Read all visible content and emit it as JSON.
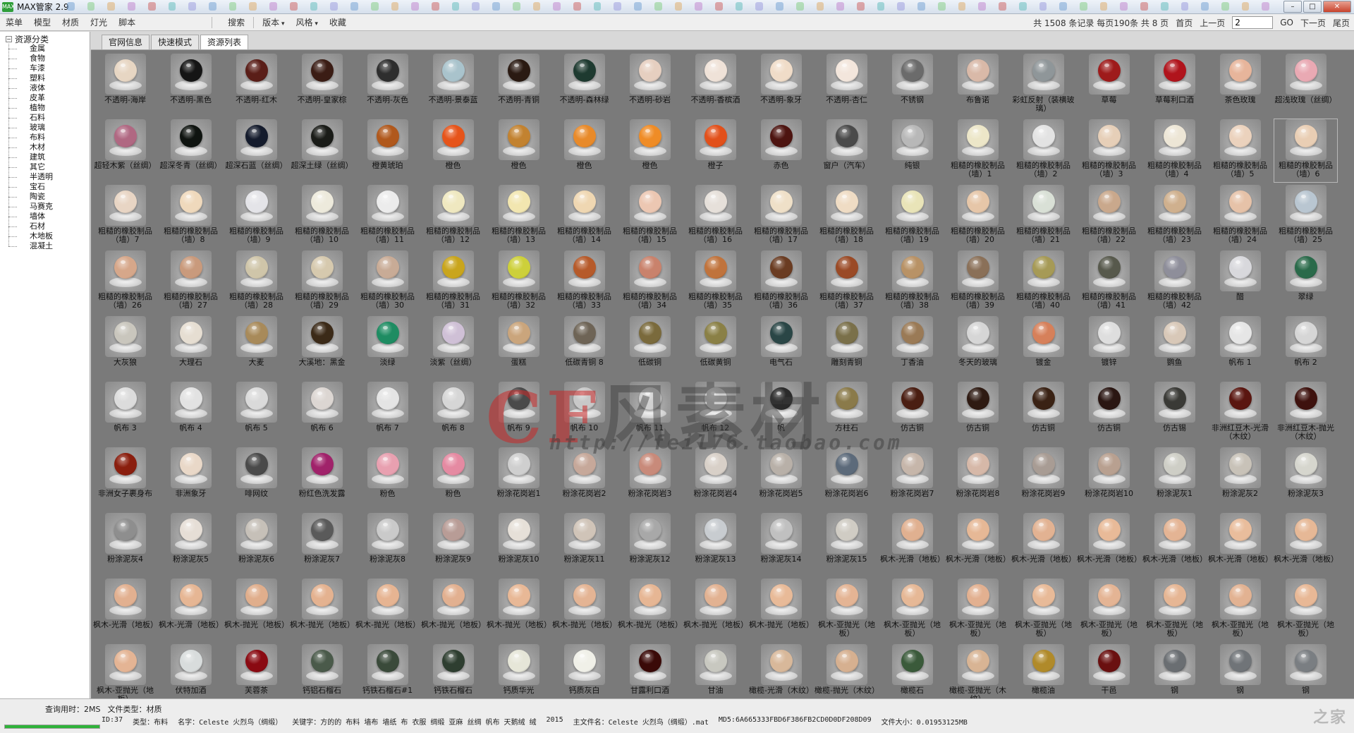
{
  "window": {
    "title": "MAX管家 2.9",
    "logo": "MAX",
    "controls": {
      "minimize": "–",
      "maximize": "□",
      "close": "✕"
    }
  },
  "menubar": {
    "items": [
      "菜单",
      "模型",
      "材质",
      "灯光",
      "脚本"
    ],
    "search": "搜索",
    "dropdowns": [
      "版本",
      "风格"
    ],
    "favorites": "收藏"
  },
  "pager": {
    "info": "共 1508 条记录 每页190条 共 8 页",
    "first": "首页",
    "prev": "上一页",
    "page_value": "2",
    "go": "GO",
    "next": "下一页",
    "last": "尾页"
  },
  "sidebar": {
    "root": "资源分类",
    "items": [
      "金属",
      "食物",
      "车漆",
      "塑料",
      "液体",
      "皮革",
      "植物",
      "石料",
      "玻璃",
      "布料",
      "木材",
      "建筑",
      "其它",
      "半透明",
      "宝石",
      "陶瓷",
      "马赛克",
      "墙体",
      "石材",
      "木地板",
      "混凝土"
    ]
  },
  "tabs": [
    "官网信息",
    "快速模式",
    "资源列表"
  ],
  "active_tab": 2,
  "selected_index": 37,
  "materials": [
    {
      "label": "不透明-海岸",
      "color": "#e7d6c3"
    },
    {
      "label": "不透明-黑色",
      "color": "#151515"
    },
    {
      "label": "不透明-红木",
      "color": "#5a1e18"
    },
    {
      "label": "不透明-皇家棕",
      "color": "#3b1d15"
    },
    {
      "label": "不透明-灰色",
      "color": "#2e2e2e"
    },
    {
      "label": "不透明-景泰蓝",
      "color": "#a9c3cc"
    },
    {
      "label": "不透明-青铜",
      "color": "#2a1a12"
    },
    {
      "label": "不透明-森林绿",
      "color": "#1e3a30"
    },
    {
      "label": "不透明-砂岩",
      "color": "#e6cfc0"
    },
    {
      "label": "不透明-香槟酒",
      "color": "#efe2d8"
    },
    {
      "label": "不透明-象牙",
      "color": "#f0dcc8"
    },
    {
      "label": "不透明-杏仁",
      "color": "#f3e6dc"
    },
    {
      "label": "不锈钢",
      "color": "#6b6b6b"
    },
    {
      "label": "布鲁诺",
      "color": "#d9b9a8"
    },
    {
      "label": "彩虹反射（装横玻璃）",
      "color": "#8f9699"
    },
    {
      "label": "草莓",
      "color": "#9e1b1b"
    },
    {
      "label": "草莓利口酒",
      "color": "#b0141c"
    },
    {
      "label": "茶色玫瑰",
      "color": "#e7b59b"
    },
    {
      "label": "超浅玫瑰（丝绸）",
      "color": "#e9a9b3"
    },
    {
      "label": "超轻木紫（丝绸）",
      "color": "#b06882"
    },
    {
      "label": "超深冬青（丝绸）",
      "color": "#0f1410"
    },
    {
      "label": "超深石蓝（丝绸）",
      "color": "#141b2c"
    },
    {
      "label": "超深土绿（丝绸）",
      "color": "#1a1c18"
    },
    {
      "label": "橙黄琥珀",
      "color": "#b0581c"
    },
    {
      "label": "橙色",
      "color": "#e6541a"
    },
    {
      "label": "橙色",
      "color": "#c28230"
    },
    {
      "label": "橙色",
      "color": "#e88a2a"
    },
    {
      "label": "橙色",
      "color": "#ef8c26"
    },
    {
      "label": "橙子",
      "color": "#e2501a"
    },
    {
      "label": "赤色",
      "color": "#4d1410"
    },
    {
      "label": "窗户（汽车）",
      "color": "#4a4a4a"
    },
    {
      "label": "纯银",
      "color": "#b8b8b8"
    },
    {
      "label": "粗糙的橡胶制品（墙）1",
      "color": "#ece6c8"
    },
    {
      "label": "粗糙的橡胶制品（墙）2",
      "color": "#e3e3e3"
    },
    {
      "label": "粗糙的橡胶制品（墙）3",
      "color": "#e6cfb8"
    },
    {
      "label": "粗糙的橡胶制品（墙）4",
      "color": "#ede6d6"
    },
    {
      "label": "粗糙的橡胶制品（墙）5",
      "color": "#ebd2bd"
    },
    {
      "label": "粗糙的橡胶制品（墙）6",
      "color": "#e9ceb4"
    },
    {
      "label": "粗糙的橡胶制品（墙）7",
      "color": "#e8d5c4"
    },
    {
      "label": "粗糙的橡胶制品（墙）8",
      "color": "#efd9bc"
    },
    {
      "label": "粗糙的橡胶制品（墙）9",
      "color": "#e4e4e8"
    },
    {
      "label": "粗糙的橡胶制品（墙）10",
      "color": "#edeadc"
    },
    {
      "label": "粗糙的橡胶制品（墙）11",
      "color": "#ececec"
    },
    {
      "label": "粗糙的橡胶制品（墙）12",
      "color": "#efe8c0"
    },
    {
      "label": "粗糙的橡胶制品（墙）13",
      "color": "#f2e6b0"
    },
    {
      "label": "粗糙的橡胶制品（墙）14",
      "color": "#efd7b2"
    },
    {
      "label": "粗糙的橡胶制品（墙）15",
      "color": "#ecc7b2"
    },
    {
      "label": "粗糙的橡胶制品（墙）16",
      "color": "#e6e0da"
    },
    {
      "label": "粗糙的橡胶制品（墙）17",
      "color": "#efe0c8"
    },
    {
      "label": "粗糙的橡胶制品（墙）18",
      "color": "#efdcc4"
    },
    {
      "label": "粗糙的橡胶制品（墙）19",
      "color": "#e9e4b8"
    },
    {
      "label": "粗糙的橡胶制品（墙）20",
      "color": "#e6c6a8"
    },
    {
      "label": "粗糙的橡胶制品（墙）21",
      "color": "#d9e0d6"
    },
    {
      "label": "粗糙的橡胶制品（墙）22",
      "color": "#c9a88c"
    },
    {
      "label": "粗糙的橡胶制品（墙）23",
      "color": "#cfb08e"
    },
    {
      "label": "粗糙的橡胶制品（墙）24",
      "color": "#e6c2a8"
    },
    {
      "label": "粗糙的橡胶制品（墙）25",
      "color": "#b9c6d1"
    },
    {
      "label": "粗糙的橡胶制品（墙）26",
      "color": "#d6a78a"
    },
    {
      "label": "粗糙的橡胶制品（墙）27",
      "color": "#c99a7c"
    },
    {
      "label": "粗糙的橡胶制品（墙）28",
      "color": "#cfc5a9"
    },
    {
      "label": "粗糙的橡胶制品（墙）29",
      "color": "#d6c9ae"
    },
    {
      "label": "粗糙的橡胶制品（墙）30",
      "color": "#c8ab96"
    },
    {
      "label": "粗糙的橡胶制品（墙）31",
      "color": "#c9a51c"
    },
    {
      "label": "粗糙的橡胶制品（墙）32",
      "color": "#cdd03a"
    },
    {
      "label": "粗糙的橡胶制品（墙）33",
      "color": "#b65a2a"
    },
    {
      "label": "粗糙的橡胶制品（墙）34",
      "color": "#c9826c"
    },
    {
      "label": "粗糙的橡胶制品（墙）35",
      "color": "#c0733c"
    },
    {
      "label": "粗糙的橡胶制品（墙）36",
      "color": "#6a3c22"
    },
    {
      "label": "粗糙的橡胶制品（墙）37",
      "color": "#9a4a26"
    },
    {
      "label": "粗糙的橡胶制品（墙）38",
      "color": "#b89266"
    },
    {
      "label": "粗糙的橡胶制品（墙）39",
      "color": "#8a7058"
    },
    {
      "label": "粗糙的橡胶制品（墙）40",
      "color": "#a69a56"
    },
    {
      "label": "粗糙的橡胶制品（墙）41",
      "color": "#57594c"
    },
    {
      "label": "粗糙的橡胶制品（墙）42",
      "color": "#8e8e9a"
    },
    {
      "label": "醋",
      "color": "#d8d8dc"
    },
    {
      "label": "翠绿",
      "color": "#2a6a4a"
    },
    {
      "label": "大灰狼",
      "color": "#c9c6bd"
    },
    {
      "label": "大理石",
      "color": "#e6ded2"
    },
    {
      "label": "大麦",
      "color": "#a88a5a"
    },
    {
      "label": "大溪地：黑金",
      "color": "#3b2a18"
    },
    {
      "label": "淡绿",
      "color": "#1e8c62"
    },
    {
      "label": "淡紫（丝绸）",
      "color": "#cfc0d6"
    },
    {
      "label": "蛋糕",
      "color": "#caa57c"
    },
    {
      "label": "低碳青铜 8",
      "color": "#6e6456"
    },
    {
      "label": "低碳铜",
      "color": "#7a6a3c"
    },
    {
      "label": "低碳黄铜",
      "color": "#8a8046"
    },
    {
      "label": "电气石",
      "color": "#2a4646"
    },
    {
      "label": "雕刻青铜",
      "color": "#7a704a"
    },
    {
      "label": "丁香油",
      "color": "#9a7a56"
    },
    {
      "label": "冬天的玻璃",
      "color": "#d6d6d6"
    },
    {
      "label": "镀金",
      "color": "#d6805a"
    },
    {
      "label": "镀锌",
      "color": "#dedede"
    },
    {
      "label": "鹦鱼",
      "color": "#d8c8b8"
    },
    {
      "label": "帆布 1",
      "color": "#e6e6e6"
    },
    {
      "label": "帆布 2",
      "color": "#d6d6d6"
    },
    {
      "label": "帆布 3",
      "color": "#dcdcdc"
    },
    {
      "label": "帆布 4",
      "color": "#e2e2e2"
    },
    {
      "label": "帆布 5",
      "color": "#dadada"
    },
    {
      "label": "帆布 6",
      "color": "#dcd6d2"
    },
    {
      "label": "帆布 7",
      "color": "#e4e4e4"
    },
    {
      "label": "帆布 8",
      "color": "#d6d6d6"
    },
    {
      "label": "帆布 9",
      "color": "#4a4a4a"
    },
    {
      "label": "帆布 10",
      "color": "#c8c8c8"
    },
    {
      "label": "帆布 11",
      "color": "#d0d0d0"
    },
    {
      "label": "帆布 12",
      "color": "#cdcdcd"
    },
    {
      "label": "帆",
      "color": "#2a2a2a"
    },
    {
      "label": "方柱石",
      "color": "#8a7a4a"
    },
    {
      "label": "仿古铜",
      "color": "#4a1e12"
    },
    {
      "label": "仿古铜",
      "color": "#2e1a12"
    },
    {
      "label": "仿古铜",
      "color": "#3a2214"
    },
    {
      "label": "仿古铜",
      "color": "#2a1612"
    },
    {
      "label": "仿古锡",
      "color": "#3a3a36"
    },
    {
      "label": "非洲红豆木-光滑（木纹）",
      "color": "#5a1610"
    },
    {
      "label": "非洲红豆木-抛光（木纹）",
      "color": "#3e120e"
    },
    {
      "label": "非洲女子裹身布",
      "color": "#8a1e0e"
    },
    {
      "label": "非洲象牙",
      "color": "#e9d8c8"
    },
    {
      "label": "啡网纹",
      "color": "#4a4a4a"
    },
    {
      "label": "粉红色洗发露",
      "color": "#a0226a"
    },
    {
      "label": "粉色",
      "color": "#e8a0b0"
    },
    {
      "label": "粉色",
      "color": "#e58aa2"
    },
    {
      "label": "粉涂花岗岩1",
      "color": "#cfcfcf"
    },
    {
      "label": "粉涂花岗岩2",
      "color": "#c6a89a"
    },
    {
      "label": "粉涂花岗岩3",
      "color": "#c88a7a"
    },
    {
      "label": "粉涂花岗岩4",
      "color": "#d8d0c8"
    },
    {
      "label": "粉涂花岗岩5",
      "color": "#b8b0a8"
    },
    {
      "label": "粉涂花岗岩6",
      "color": "#5c6a7a"
    },
    {
      "label": "粉涂花岗岩7",
      "color": "#c6b6aa"
    },
    {
      "label": "粉涂花岗岩8",
      "color": "#d6b8a8"
    },
    {
      "label": "粉涂花岗岩9",
      "color": "#a89c94"
    },
    {
      "label": "粉涂花岗岩10",
      "color": "#b8a090"
    },
    {
      "label": "粉涂泥灰1",
      "color": "#cecec6"
    },
    {
      "label": "粉涂泥灰2",
      "color": "#c8c2b8"
    },
    {
      "label": "粉涂泥灰3",
      "color": "#d6d6ce"
    },
    {
      "label": "粉涂泥灰4",
      "color": "#8e8e8e"
    },
    {
      "label": "粉涂泥灰5",
      "color": "#e6ded6"
    },
    {
      "label": "粉涂泥灰6",
      "color": "#c6c0b8"
    },
    {
      "label": "粉涂泥灰7",
      "color": "#5a5a5a"
    },
    {
      "label": "粉涂泥灰8",
      "color": "#cacaca"
    },
    {
      "label": "粉涂泥灰9",
      "color": "#b89c96"
    },
    {
      "label": "粉涂泥灰10",
      "color": "#e6e0d8"
    },
    {
      "label": "粉涂泥灰11",
      "color": "#d0c4b8"
    },
    {
      "label": "粉涂泥灰12",
      "color": "#a8a8a8"
    },
    {
      "label": "粉涂泥灰13",
      "color": "#c8ccd0"
    },
    {
      "label": "粉涂泥灰14",
      "color": "#c0c0c0"
    },
    {
      "label": "粉涂泥灰15",
      "color": "#d0ccc4"
    },
    {
      "label": "枫木-光滑（地板）",
      "color": "#e0b090"
    },
    {
      "label": "枫木-光滑（地板）",
      "color": "#e6b896"
    },
    {
      "label": "枫木-光滑（地板）",
      "color": "#e2b292"
    },
    {
      "label": "枫木-光滑（地板）",
      "color": "#e8ba98"
    },
    {
      "label": "枫木-光滑（地板）",
      "color": "#e4b494"
    },
    {
      "label": "枫木-光滑（地板）",
      "color": "#e9bd9c"
    },
    {
      "label": "枫木-光滑（地板）",
      "color": "#e6b896"
    },
    {
      "label": "枫木-光滑（地板）",
      "color": "#e2b090"
    },
    {
      "label": "枫木-光滑（地板）",
      "color": "#e6b694"
    },
    {
      "label": "枫木-抛光（地板）",
      "color": "#e0ae8c"
    },
    {
      "label": "枫木-抛光（地板）",
      "color": "#e4b290"
    },
    {
      "label": "枫木-抛光（地板）",
      "color": "#e6b492"
    },
    {
      "label": "枫木-抛光（地板）",
      "color": "#e2b090"
    },
    {
      "label": "枫木-抛光（地板）",
      "color": "#e8b896"
    },
    {
      "label": "枫木-抛光（地板）",
      "color": "#e4b494"
    },
    {
      "label": "枫木-抛光（地板）",
      "color": "#e6b694"
    },
    {
      "label": "枫木-抛光（地板）",
      "color": "#e2b292"
    },
    {
      "label": "枫木-抛光（地板）",
      "color": "#e8ba98"
    },
    {
      "label": "枫木-亚抛光（地板）",
      "color": "#e4b494"
    },
    {
      "label": "枫木-亚抛光（地板）",
      "color": "#e6b896"
    },
    {
      "label": "枫木-亚抛光（地板）",
      "color": "#e2b090"
    },
    {
      "label": "枫木-亚抛光（地板）",
      "color": "#e8ba98"
    },
    {
      "label": "枫木-亚抛光（地板）",
      "color": "#e4b494"
    },
    {
      "label": "枫木-亚抛光（地板）",
      "color": "#e6b694"
    },
    {
      "label": "枫木-亚抛光（地板）",
      "color": "#e2b292"
    },
    {
      "label": "枫木-亚抛光（地板）",
      "color": "#e8b896"
    },
    {
      "label": "枫木-亚抛光（地板）",
      "color": "#e4b494"
    },
    {
      "label": "伏特加酒",
      "color": "#d8dcdc"
    },
    {
      "label": "芙蓉茶",
      "color": "#8a0a12"
    },
    {
      "label": "钙铝石榴石",
      "color": "#4a5a4a"
    },
    {
      "label": "钙铁石榴石#1",
      "color": "#3a4a3a"
    },
    {
      "label": "钙铁石榴石",
      "color": "#2e3e30"
    },
    {
      "label": "钙质华光",
      "color": "#e6e6d8"
    },
    {
      "label": "钙质灰白",
      "color": "#f0f0e8"
    },
    {
      "label": "甘露利口酒",
      "color": "#3a0a08"
    },
    {
      "label": "甘油",
      "color": "#c8c8c0"
    },
    {
      "label": "橄榄-光滑（木纹）",
      "color": "#d8b89a"
    },
    {
      "label": "橄榄-抛光（木纹）",
      "color": "#d6b090"
    },
    {
      "label": "橄榄石",
      "color": "#3a5a3a"
    },
    {
      "label": "橄榄-亚抛光（木纹）",
      "color": "#d8b494"
    },
    {
      "label": "橄榄油",
      "color": "#b08a2a"
    },
    {
      "label": "干邑",
      "color": "#6a1010"
    },
    {
      "label": "钢",
      "color": "#6a6e72"
    },
    {
      "label": "钢",
      "color": "#707478"
    },
    {
      "label": "钢",
      "color": "#7a7e82"
    }
  ],
  "status": {
    "query_time": "查询用时：2MS",
    "file_type": "文件类型：材质",
    "id": "ID:37",
    "category": "类型：布料",
    "name": "名字：Celeste 火烈鸟（绸缎）",
    "keywords": "关键字：方的的 布料 墙布 墙纸 布 衣服 绸缎 亚麻 丝绸 帆布 天鹅绒 绒",
    "year": "2015",
    "main_file": "主文件名：Celeste 火烈鸟（绸缎）.mat",
    "md5": "MD5:6A665333FBD6F386FB2CD0D0DF208D09",
    "file_size": "文件大小：0.01953125MB",
    "progress": 1.0
  },
  "watermark": {
    "main": "风素材",
    "mark": "CF",
    "url": "http://feil76.taobao.com",
    "corner": "之家"
  }
}
